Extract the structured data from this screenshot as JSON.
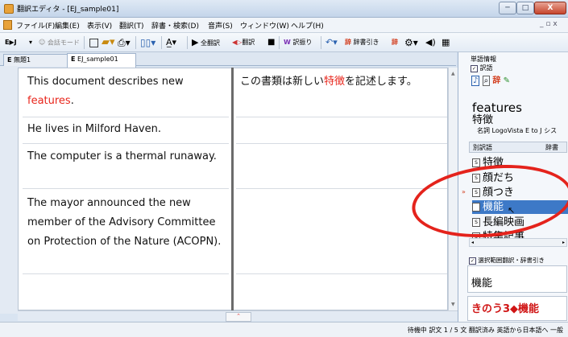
{
  "window": {
    "title": "翻訳エディタ - [EJ_sample01]",
    "buttons": {
      "minimize": "─",
      "maximize": "□",
      "close": "X"
    }
  },
  "menu": [
    "ファイル(F)",
    "編集(E)",
    "表示(V)",
    "翻訳(T)",
    "辞書・検索(D)",
    "音声(S)",
    "ウィンドウ(W)",
    "ヘルプ(H)"
  ],
  "toolbar": {
    "mode": "E▶J",
    "conversation_mode": "会話モード",
    "translate_all": "全翻訳",
    "translate": "翻訳",
    "alternatives": "訳振り",
    "dictionary_lookup": "辞書引き"
  },
  "tabs": [
    {
      "prefix": "E",
      "label": "無題1"
    },
    {
      "prefix": "E",
      "label": "EJ_sample01"
    }
  ],
  "editor": {
    "source": [
      {
        "before": "This document describes new",
        "highlight": "features",
        "after": "."
      },
      {
        "text": "He lives in Milford Haven."
      },
      {
        "text": "The computer is a thermal runaway."
      },
      {
        "text": "The mayor announced the new member of the Advisory Committee on Protection of the Nature (ACOPN)."
      }
    ],
    "target": [
      {
        "before": "この書類は新しい",
        "highlight": "特徴",
        "after": "を記述します。"
      }
    ]
  },
  "right_pane": {
    "header": "単語情報",
    "checkbox_label": "訳語",
    "word": "features",
    "translation": "特徴",
    "pos_source": "名詞  LogoVista E to J シス",
    "column_alternatives": "別訳語",
    "column_dict": "辞書",
    "alternatives": [
      "特徴",
      "顔だち",
      "顔つき",
      "機能",
      "長編映画",
      "特集記事"
    ],
    "selected_alternative": "機能",
    "lookup_checkbox": "選択範囲翻訳・辞書引き",
    "lookup_word": "機能",
    "lookup_result": "きのう3◆機能"
  },
  "status": {
    "text": "待機中  訳文   1 / 5 文  翻訳済み  英語から日本語へ  一般"
  },
  "colors": {
    "highlight": "#e8251b",
    "selection": "#3d79c7",
    "annotation": "#e4231c"
  }
}
